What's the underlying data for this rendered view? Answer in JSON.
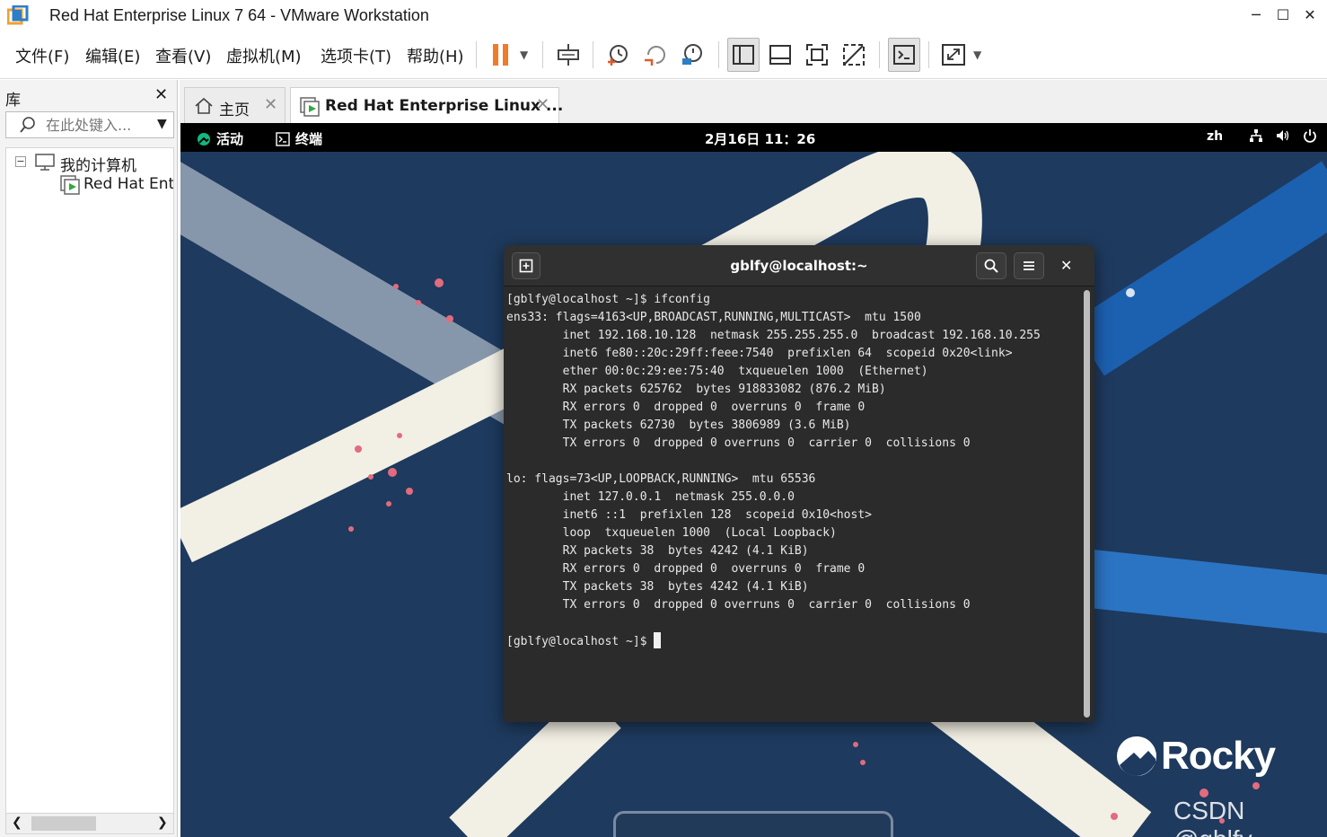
{
  "window": {
    "title": "Red Hat Enterprise Linux 7 64 - VMware Workstation",
    "minimize_glyph": "─",
    "maximize_glyph": "☐",
    "close_glyph": "✕"
  },
  "menu": {
    "file": "文件(F)",
    "edit": "编辑(E)",
    "view": "查看(V)",
    "vm": "虚拟机(M)",
    "tabs": "选项卡(T)",
    "help": "帮助(H)"
  },
  "toolbar": {
    "icons": [
      "pause-icon",
      "send-ctrl-alt-del-icon",
      "snapshot-icon",
      "revert-snapshot-icon",
      "snapshot-manager-icon",
      "library-view-icon",
      "thumbnail-view-icon",
      "fullscreen-icon",
      "unity-icon",
      "console-view-icon",
      "stretch-icon"
    ],
    "pause_color": "#f07c2a"
  },
  "library": {
    "title": "库",
    "close_glyph": "✕",
    "search_placeholder": "在此处键入...",
    "tree_root": "我的计算机",
    "tree_vm": "Red Hat Ent"
  },
  "tabs": {
    "home": "主页",
    "vm": "Red Hat Enterprise Linux ...",
    "close_glyph": "✕"
  },
  "guest": {
    "activities": "活动",
    "app_name": "终端",
    "clock": "2月16日  11：26",
    "lang": "zh",
    "logo_text": "Rocky",
    "watermark": "CSDN @gblfy",
    "wallpaper_color": "#1e3a5e"
  },
  "terminal": {
    "title": "gblfy@localhost:~",
    "lines": [
      "[gblfy@localhost ~]$ ifconfig",
      "ens33: flags=4163<UP,BROADCAST,RUNNING,MULTICAST>  mtu 1500",
      "        inet 192.168.10.128  netmask 255.255.255.0  broadcast 192.168.10.255",
      "        inet6 fe80::20c:29ff:feee:7540  prefixlen 64  scopeid 0x20<link>",
      "        ether 00:0c:29:ee:75:40  txqueuelen 1000  (Ethernet)",
      "        RX packets 625762  bytes 918833082 (876.2 MiB)",
      "        RX errors 0  dropped 0  overruns 0  frame 0",
      "        TX packets 62730  bytes 3806989 (3.6 MiB)",
      "        TX errors 0  dropped 0 overruns 0  carrier 0  collisions 0",
      "",
      "lo: flags=73<UP,LOOPBACK,RUNNING>  mtu 65536",
      "        inet 127.0.0.1  netmask 255.0.0.0",
      "        inet6 ::1  prefixlen 128  scopeid 0x10<host>",
      "        loop  txqueuelen 1000  (Local Loopback)",
      "        RX packets 38  bytes 4242 (4.1 KiB)",
      "        RX errors 0  dropped 0  overruns 0  frame 0",
      "        TX packets 38  bytes 4242 (4.1 KiB)",
      "        TX errors 0  dropped 0 overruns 0  carrier 0  collisions 0",
      ""
    ],
    "prompt": "[gblfy@localhost ~]$ "
  }
}
